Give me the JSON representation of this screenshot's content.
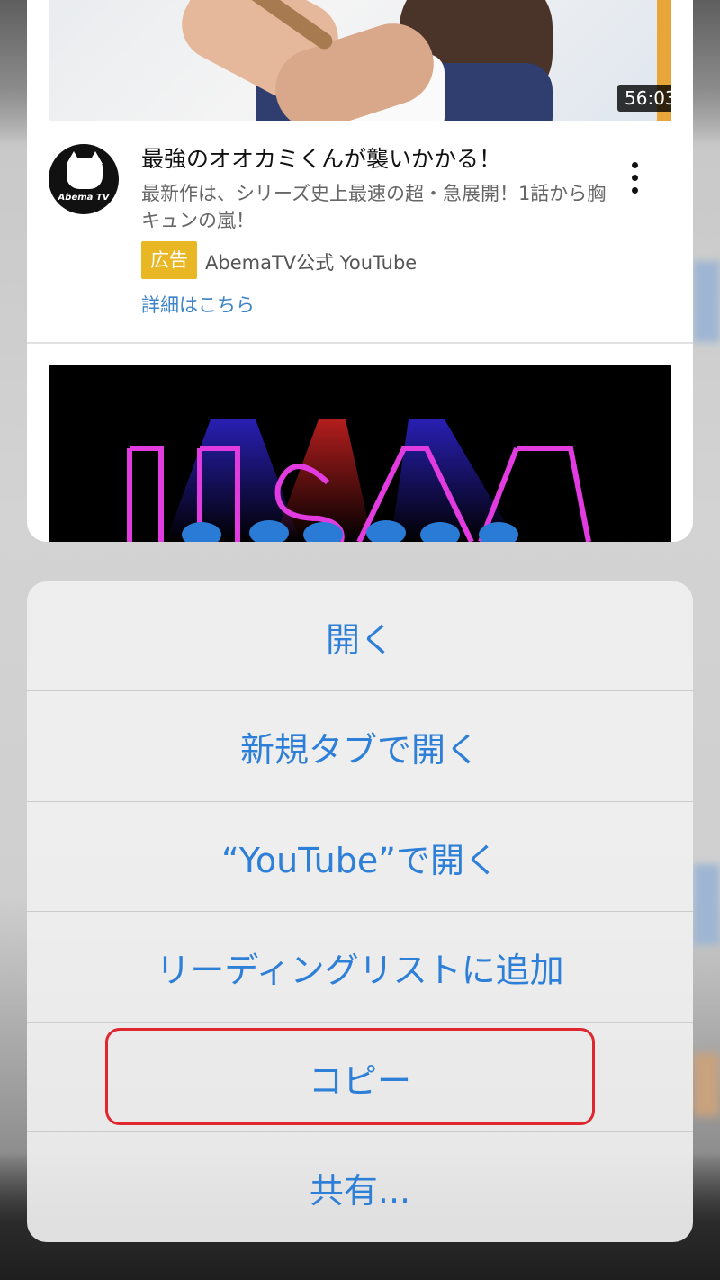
{
  "preview": {
    "video_duration": "56:03",
    "video_title": "最強のオオカミくんが襲いかかる！",
    "video_description": "最新作は、シリーズ史上最速の超・急展開！1話から胸キュンの嵐！",
    "ad_badge": "広告",
    "channel_name": "AbemaTV公式 YouTube",
    "details_link": "詳細はこちら",
    "avatar_label": "Abema TV"
  },
  "action_sheet": {
    "items": [
      {
        "label": "開く"
      },
      {
        "label": "新規タブで開く"
      },
      {
        "label": "“YouTube”で開く"
      },
      {
        "label": "リーディングリストに追加"
      },
      {
        "label": "コピー"
      },
      {
        "label": "共有..."
      }
    ]
  },
  "colors": {
    "action_text": "#2e7fd8",
    "highlight_border": "#e0262e",
    "ad_badge": "#e9b723",
    "link": "#3d83c9"
  }
}
